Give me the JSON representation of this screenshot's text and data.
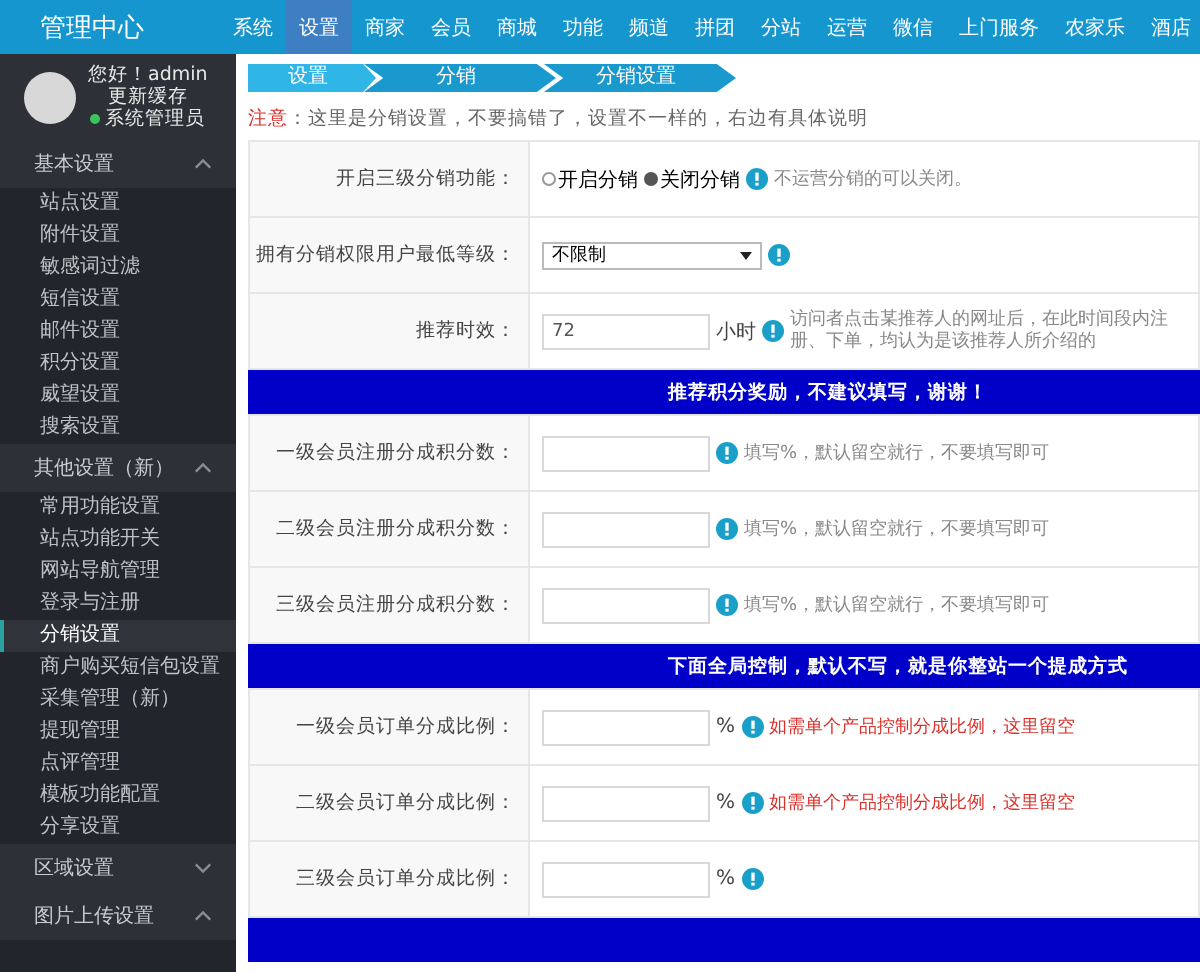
{
  "header": {
    "logo": "管理中心",
    "nav": [
      {
        "label": "系统",
        "selected": false
      },
      {
        "label": "设置",
        "selected": true
      },
      {
        "label": "商家",
        "selected": false
      },
      {
        "label": "会员",
        "selected": false
      },
      {
        "label": "商城",
        "selected": false
      },
      {
        "label": "功能",
        "selected": false
      },
      {
        "label": "频道",
        "selected": false
      },
      {
        "label": "拼团",
        "selected": false
      },
      {
        "label": "分站",
        "selected": false
      },
      {
        "label": "运营",
        "selected": false
      },
      {
        "label": "微信",
        "selected": false
      },
      {
        "label": "上门服务",
        "selected": false
      },
      {
        "label": "农家乐",
        "selected": false
      },
      {
        "label": "酒店",
        "selected": false
      }
    ]
  },
  "user": {
    "greeting": "您好！admin",
    "refresh": "更新缓存",
    "role": "系统管理员"
  },
  "sidebar": [
    {
      "title": "基本设置",
      "expanded": true,
      "children": [
        {
          "label": "站点设置",
          "selected": false
        },
        {
          "label": "附件设置",
          "selected": false
        },
        {
          "label": "敏感词过滤",
          "selected": false
        },
        {
          "label": "短信设置",
          "selected": false
        },
        {
          "label": "邮件设置",
          "selected": false
        },
        {
          "label": "积分设置",
          "selected": false
        },
        {
          "label": "威望设置",
          "selected": false
        },
        {
          "label": "搜索设置",
          "selected": false
        }
      ]
    },
    {
      "title": "其他设置（新）",
      "expanded": true,
      "children": [
        {
          "label": "常用功能设置",
          "selected": false
        },
        {
          "label": "站点功能开关",
          "selected": false
        },
        {
          "label": "网站导航管理",
          "selected": false
        },
        {
          "label": "登录与注册",
          "selected": false
        },
        {
          "label": "分销设置",
          "selected": true
        },
        {
          "label": "商户购买短信包设置",
          "selected": false
        },
        {
          "label": "采集管理（新）",
          "selected": false
        },
        {
          "label": "提现管理",
          "selected": false
        },
        {
          "label": "点评管理",
          "selected": false
        },
        {
          "label": "模板功能配置",
          "selected": false
        },
        {
          "label": "分享设置",
          "selected": false
        }
      ]
    },
    {
      "title": "区域设置",
      "expanded": false
    },
    {
      "title": "图片上传设置",
      "expanded": true
    }
  ],
  "breadcrumb": [
    "设置",
    "分销",
    "分销设置"
  ],
  "notice": {
    "label": "注意",
    "text": "：这里是分销设置，不要搞错了，设置不一样的，右边有具体说明"
  },
  "form": [
    {
      "kind": "radio",
      "label": "开启三级分销功能：",
      "options": [
        {
          "label": "开启分销",
          "selected": false
        },
        {
          "label": "关闭分销",
          "selected": true
        }
      ],
      "hint": "不运营分销的可以关闭。"
    },
    {
      "kind": "select",
      "label": "拥有分销权限用户最低等级：",
      "value": "不限制"
    },
    {
      "kind": "input",
      "label": "推荐时效：",
      "value": "72",
      "unit": "小时",
      "hint": "访问者点击某推荐人的网址后，在此时间段内注册、下单，均认为是该推荐人所介绍的"
    },
    {
      "kind": "band",
      "title": "推荐积分奖励，不建议填写，谢谢！"
    },
    {
      "kind": "input",
      "label": "一级会员注册分成积分数：",
      "hint": "填写%，默认留空就行，不要填写即可"
    },
    {
      "kind": "input",
      "label": "二级会员注册分成积分数：",
      "hint": "填写%，默认留空就行，不要填写即可"
    },
    {
      "kind": "input",
      "label": "三级会员注册分成积分数：",
      "hint": "填写%，默认留空就行，不要填写即可"
    },
    {
      "kind": "band",
      "title": "下面全局控制，默认不写，就是你整站一个提成方式"
    },
    {
      "kind": "input",
      "label": "一级会员订单分成比例：",
      "unit": "%",
      "hint": "如需单个产品控制分成比例，这里留空",
      "warn": true
    },
    {
      "kind": "input",
      "label": "二级会员订单分成比例：",
      "unit": "%",
      "hint": "如需单个产品控制分成比例，这里留空",
      "warn": true
    },
    {
      "kind": "input",
      "label": "三级会员订单分成比例：",
      "unit": "%"
    },
    {
      "kind": "band"
    }
  ]
}
